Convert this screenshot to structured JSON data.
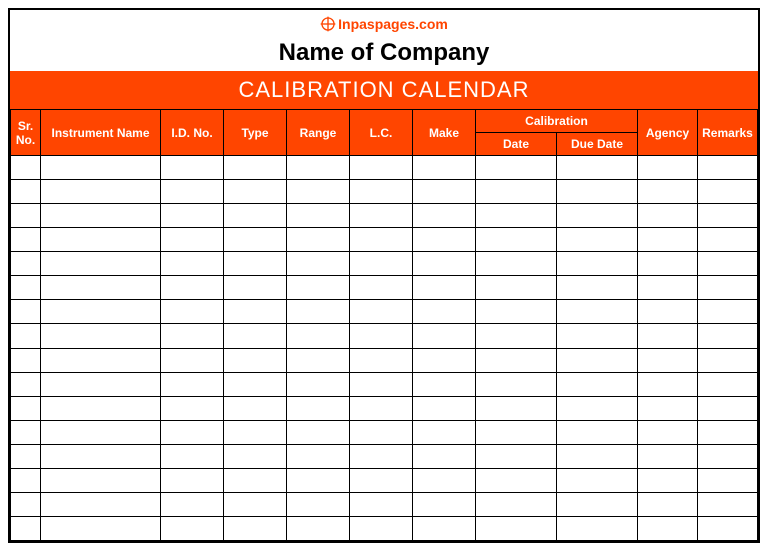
{
  "logo": {
    "text": "Inpaspages.com",
    "icon_name": "compass-cross-icon",
    "color": "#ff4500"
  },
  "company_name": "Name of Company",
  "title": "CALIBRATION CALENDAR",
  "columns": {
    "sr_no": "Sr. No.",
    "instrument_name": "Instrument Name",
    "id_no": "I.D. No.",
    "type": "Type",
    "range": "Range",
    "lc": "L.C.",
    "make": "Make",
    "calibration_group": "Calibration",
    "calibration_date": "Date",
    "calibration_due_date": "Due Date",
    "agency": "Agency",
    "remarks": "Remarks"
  },
  "rows": [
    {
      "sr": "",
      "instrument_name": "",
      "id_no": "",
      "type": "",
      "range": "",
      "lc": "",
      "make": "",
      "cal_date": "",
      "cal_due": "",
      "agency": "",
      "remarks": ""
    },
    {
      "sr": "",
      "instrument_name": "",
      "id_no": "",
      "type": "",
      "range": "",
      "lc": "",
      "make": "",
      "cal_date": "",
      "cal_due": "",
      "agency": "",
      "remarks": ""
    },
    {
      "sr": "",
      "instrument_name": "",
      "id_no": "",
      "type": "",
      "range": "",
      "lc": "",
      "make": "",
      "cal_date": "",
      "cal_due": "",
      "agency": "",
      "remarks": ""
    },
    {
      "sr": "",
      "instrument_name": "",
      "id_no": "",
      "type": "",
      "range": "",
      "lc": "",
      "make": "",
      "cal_date": "",
      "cal_due": "",
      "agency": "",
      "remarks": ""
    },
    {
      "sr": "",
      "instrument_name": "",
      "id_no": "",
      "type": "",
      "range": "",
      "lc": "",
      "make": "",
      "cal_date": "",
      "cal_due": "",
      "agency": "",
      "remarks": ""
    },
    {
      "sr": "",
      "instrument_name": "",
      "id_no": "",
      "type": "",
      "range": "",
      "lc": "",
      "make": "",
      "cal_date": "",
      "cal_due": "",
      "agency": "",
      "remarks": ""
    },
    {
      "sr": "",
      "instrument_name": "",
      "id_no": "",
      "type": "",
      "range": "",
      "lc": "",
      "make": "",
      "cal_date": "",
      "cal_due": "",
      "agency": "",
      "remarks": ""
    },
    {
      "sr": "",
      "instrument_name": "",
      "id_no": "",
      "type": "",
      "range": "",
      "lc": "",
      "make": "",
      "cal_date": "",
      "cal_due": "",
      "agency": "",
      "remarks": ""
    },
    {
      "sr": "",
      "instrument_name": "",
      "id_no": "",
      "type": "",
      "range": "",
      "lc": "",
      "make": "",
      "cal_date": "",
      "cal_due": "",
      "agency": "",
      "remarks": ""
    },
    {
      "sr": "",
      "instrument_name": "",
      "id_no": "",
      "type": "",
      "range": "",
      "lc": "",
      "make": "",
      "cal_date": "",
      "cal_due": "",
      "agency": "",
      "remarks": ""
    },
    {
      "sr": "",
      "instrument_name": "",
      "id_no": "",
      "type": "",
      "range": "",
      "lc": "",
      "make": "",
      "cal_date": "",
      "cal_due": "",
      "agency": "",
      "remarks": ""
    },
    {
      "sr": "",
      "instrument_name": "",
      "id_no": "",
      "type": "",
      "range": "",
      "lc": "",
      "make": "",
      "cal_date": "",
      "cal_due": "",
      "agency": "",
      "remarks": ""
    },
    {
      "sr": "",
      "instrument_name": "",
      "id_no": "",
      "type": "",
      "range": "",
      "lc": "",
      "make": "",
      "cal_date": "",
      "cal_due": "",
      "agency": "",
      "remarks": ""
    },
    {
      "sr": "",
      "instrument_name": "",
      "id_no": "",
      "type": "",
      "range": "",
      "lc": "",
      "make": "",
      "cal_date": "",
      "cal_due": "",
      "agency": "",
      "remarks": ""
    },
    {
      "sr": "",
      "instrument_name": "",
      "id_no": "",
      "type": "",
      "range": "",
      "lc": "",
      "make": "",
      "cal_date": "",
      "cal_due": "",
      "agency": "",
      "remarks": ""
    },
    {
      "sr": "",
      "instrument_name": "",
      "id_no": "",
      "type": "",
      "range": "",
      "lc": "",
      "make": "",
      "cal_date": "",
      "cal_due": "",
      "agency": "",
      "remarks": ""
    }
  ]
}
